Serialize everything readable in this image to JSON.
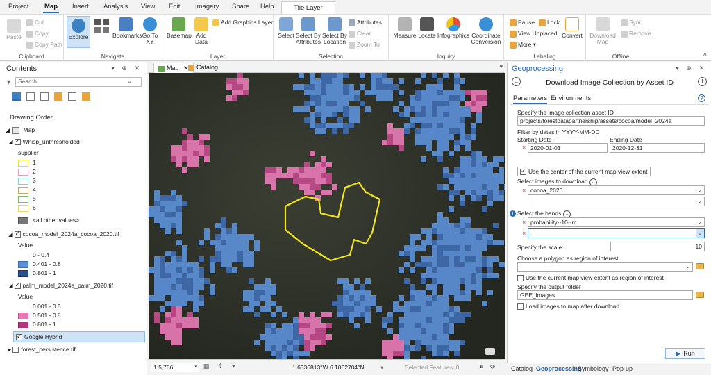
{
  "tabs": [
    "Project",
    "Map",
    "Insert",
    "Analysis",
    "View",
    "Edit",
    "Imagery",
    "Share",
    "Help"
  ],
  "tile_layer_tab": "Tile Layer",
  "ribbon": {
    "clipboard": {
      "label": "Clipboard",
      "paste": "Paste",
      "cut": "Cut",
      "copy": "Copy",
      "copy_path": "Copy Path"
    },
    "navigate": {
      "label": "Navigate",
      "explore": "Explore",
      "bookmarks": "Bookmarks",
      "goto": "Go To XY"
    },
    "layer": {
      "label": "Layer",
      "basemap": "Basemap",
      "add_data": "Add Data",
      "add_graphics": "Add Graphics Layer"
    },
    "selection": {
      "label": "Selection",
      "select": "Select",
      "by_attr": "Select By Attributes",
      "by_loc": "Select By Location",
      "attributes": "Attributes",
      "clear": "Clear",
      "zoom_to": "Zoom To"
    },
    "inquiry": {
      "label": "Inquiry",
      "measure": "Measure",
      "locate": "Locate",
      "infographics": "Infographics",
      "coord": "Coordinate Conversion"
    },
    "labeling": {
      "label": "Labeling",
      "pause": "Pause",
      "lock": "Lock",
      "view_unplaced": "View Unplaced",
      "more": "More",
      "convert": "Convert"
    },
    "offline": {
      "label": "Offline",
      "download": "Download Map",
      "sync": "Sync",
      "remove": "Remove"
    }
  },
  "contents": {
    "title": "Contents",
    "search_placeholder": "Search",
    "drawing_order": "Drawing Order",
    "map": "Map",
    "layers": [
      {
        "name": "Whisp_unthresholded",
        "field": "supplier",
        "classes": [
          {
            "label": "1",
            "color": "#f5f07a"
          },
          {
            "label": "2",
            "color": "#f7c9d9"
          },
          {
            "label": "3",
            "color": "#bfe8e4"
          },
          {
            "label": "4",
            "color": "#f1d9b5"
          },
          {
            "label": "5",
            "color": "#d4ecc8"
          },
          {
            "label": "6",
            "color": "#fbf5b8"
          },
          {
            "label": "<all other values>",
            "color": "#777777"
          }
        ]
      },
      {
        "name": "cocoa_model_2024a_cocoa_2020.tif",
        "field": "Value",
        "classes": [
          {
            "label": "0 - 0.4",
            "color": "#ffffff"
          },
          {
            "label": "0.401 - 0.8",
            "color": "#5b8fd6"
          },
          {
            "label": "0.801 - 1",
            "color": "#2c4f8a"
          }
        ]
      },
      {
        "name": "palm_model_2024a_palm_2020.tif",
        "field": "Value",
        "classes": [
          {
            "label": "0.001 - 0.5",
            "color": "#ffffff"
          },
          {
            "label": "0.501 - 0.8",
            "color": "#e679b5"
          },
          {
            "label": "0.801 - 1",
            "color": "#b0387a"
          }
        ]
      },
      {
        "name": "Google Hybrid"
      },
      {
        "name": "forest_persistence.tif"
      }
    ]
  },
  "map_tabs": {
    "map": "Map",
    "catalog": "Catalog"
  },
  "map_status": {
    "scale": "1:5,766",
    "coords": "1.6336813°W 6.1002704°N",
    "selected": "Selected Features: 0"
  },
  "geoprocessing": {
    "title": "Geoprocessing",
    "tool": "Download Image Collection by Asset ID",
    "tab_params": "Parameters",
    "tab_env": "Environments",
    "asset_label": "Specify the image collection asset ID",
    "asset_value": "projects/forestdatapartnership/assets/cocoa/model_2024a",
    "filter_label": "Filter by dates in YYYY-MM-DD",
    "start_label": "Starting Date",
    "start_value": "2020-01-01",
    "end_label": "Ending Date",
    "end_value": "2020-12-31",
    "use_center": "Use the center of the current map view extent",
    "images_label": "Select images to download",
    "image_value": "cocoa_2020",
    "bands_label": "Select the bands",
    "band_value": "probability--10--m",
    "scale_label": "Specify the scale",
    "scale_value": "10",
    "polygon_label": "Choose a polygon as region of interest",
    "use_extent": "Use the current map view extent as region of interest",
    "folder_label": "Specify the output folder",
    "folder_value": "GEE_images",
    "load_images": "Load images to map after download",
    "run": "Run"
  },
  "bottom_tabs": [
    "Catalog",
    "Geoprocessing",
    "Symbology",
    "Pop-up"
  ]
}
